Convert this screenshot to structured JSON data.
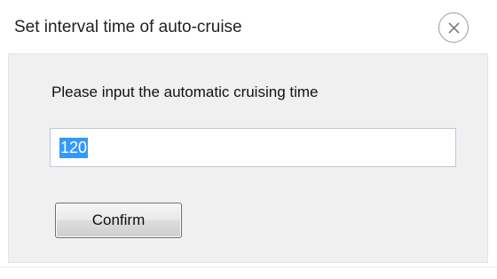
{
  "window": {
    "title": "Set interval time of auto-cruise",
    "close_icon": "close-icon"
  },
  "form": {
    "prompt": "Please input the automatic cruising time",
    "cruise_time_value": "120",
    "confirm_label": "Confirm"
  },
  "colors": {
    "selection": "#3399ff",
    "body_background": "#f0f0f0",
    "input_border": "#b9c9da"
  }
}
